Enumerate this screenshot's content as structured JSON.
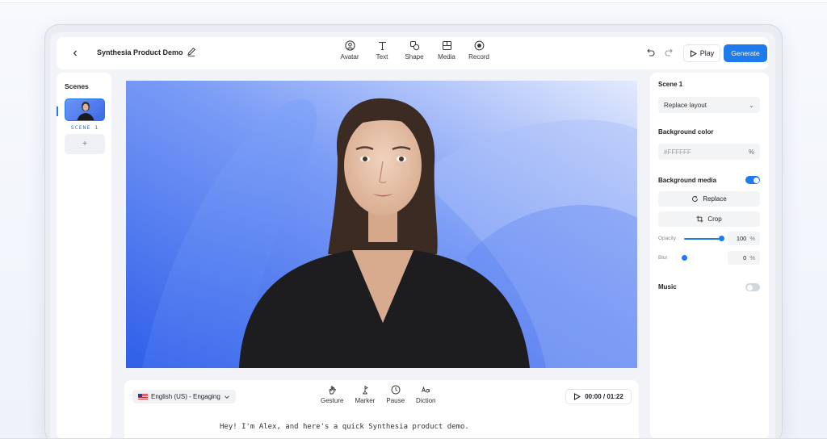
{
  "header": {
    "back_label": "‹",
    "project_title": "Synthesia Product Demo",
    "tools": [
      {
        "label": "Avatar",
        "icon": "avatar-icon"
      },
      {
        "label": "Text",
        "icon": "text-icon"
      },
      {
        "label": "Shape",
        "icon": "shape-icon"
      },
      {
        "label": "Media",
        "icon": "media-icon"
      },
      {
        "label": "Record",
        "icon": "record-icon"
      }
    ],
    "play_label": "Play",
    "generate_label": "Generate"
  },
  "scenes": {
    "title": "Scenes",
    "items": [
      {
        "label": "SCENE 1"
      }
    ],
    "add_label": "+"
  },
  "script": {
    "language": "English (US) - Engaging",
    "tools": [
      {
        "label": "Gesture",
        "icon": "gesture-icon"
      },
      {
        "label": "Marker",
        "icon": "marker-icon"
      },
      {
        "label": "Pause",
        "icon": "pause-clock-icon"
      },
      {
        "label": "Diction",
        "icon": "diction-icon"
      }
    ],
    "timer": "00:00 / 01:22",
    "text": "Hey! I'm Alex, and here's a quick Synthesia product demo."
  },
  "panel": {
    "scene_title": "Scene 1",
    "layout_select": "Replace layout",
    "bg_color_title": "Background color",
    "bg_color_value": "#FFFFFF",
    "bg_color_unit": "%",
    "bg_media_title": "Background media",
    "bg_media_more": "···",
    "bg_media_enabled": true,
    "replace_label": "Replace",
    "crop_label": "Crop",
    "opacity_label": "Opacity",
    "opacity_value": "100",
    "opacity_unit": "%",
    "opacity_fraction": 1.0,
    "blur_label": "Blur",
    "blur_value": "0",
    "blur_unit": "%",
    "blur_fraction": 0.0,
    "music_title": "Music",
    "music_enabled": false
  },
  "colors": {
    "accent": "#1f7aeb",
    "canvas_bg": "#3c6af1",
    "toggle_off": "#d2d6dd"
  }
}
